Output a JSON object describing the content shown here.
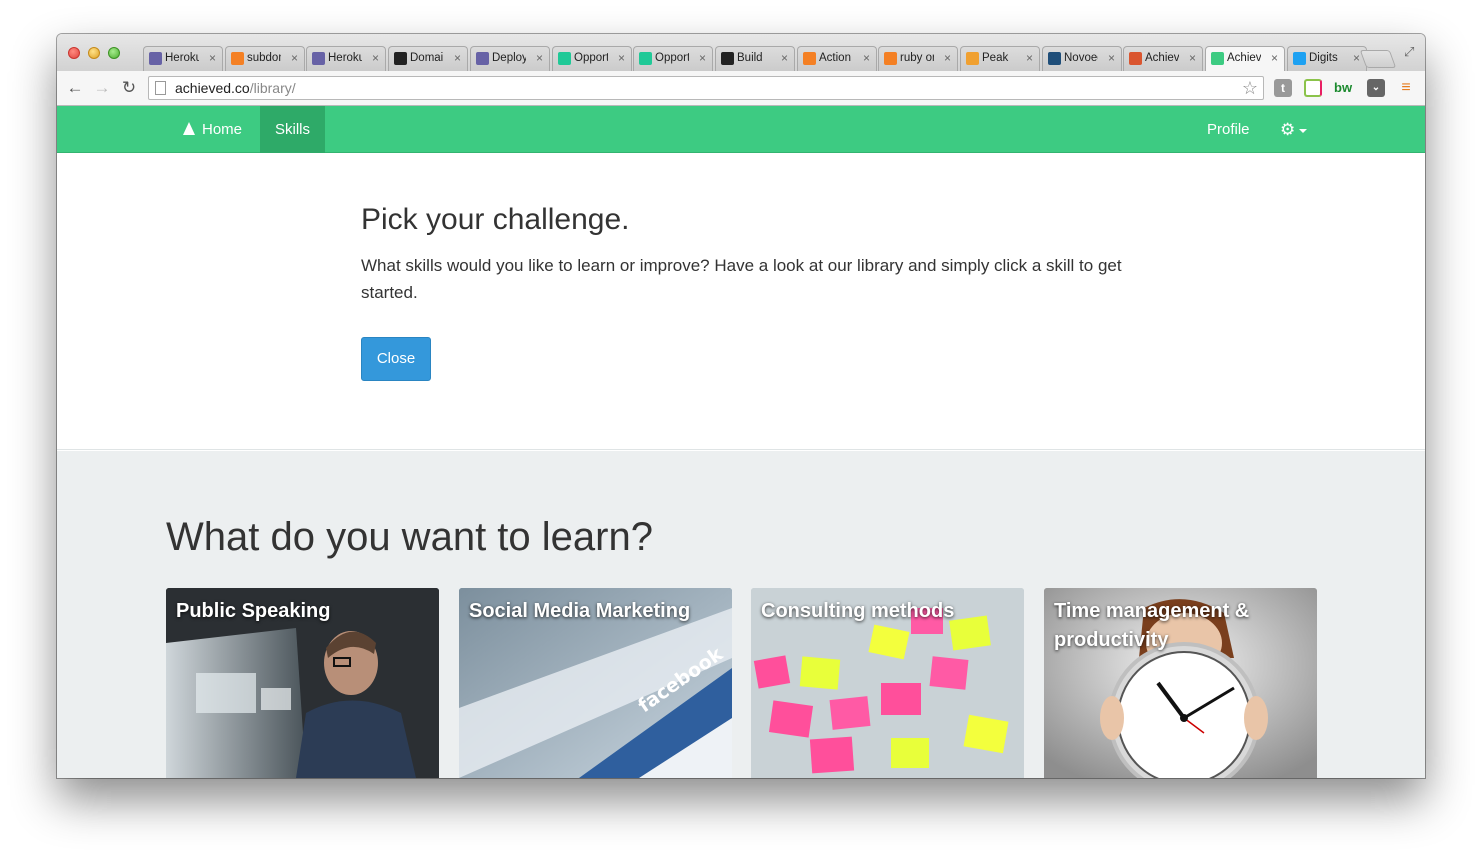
{
  "browser": {
    "tabs": [
      {
        "title": "Heroku",
        "favicon": "heroku-icon",
        "color": "#6762a6"
      },
      {
        "title": "subdomain",
        "favicon": "stackoverflow-icon",
        "color": "#f48024"
      },
      {
        "title": "Heroku",
        "favicon": "heroku-icon",
        "color": "#6762a6"
      },
      {
        "title": "Domains",
        "favicon": "domain-icon",
        "color": "#222222"
      },
      {
        "title": "Deploy",
        "favicon": "heroku-icon",
        "color": "#6762a6"
      },
      {
        "title": "Opportunity",
        "favicon": "circle-icon",
        "color": "#20c997"
      },
      {
        "title": "Opportunity",
        "favicon": "circle-icon",
        "color": "#20c997"
      },
      {
        "title": "Build",
        "favicon": "square-icon",
        "color": "#222222"
      },
      {
        "title": "Action",
        "favicon": "stackoverflow-icon",
        "color": "#f48024"
      },
      {
        "title": "ruby on",
        "favicon": "stackoverflow-icon",
        "color": "#f48024"
      },
      {
        "title": "Peak",
        "favicon": "peak-icon",
        "color": "#f0a030"
      },
      {
        "title": "Novoed",
        "favicon": "novoed-icon",
        "color": "#1f4e79"
      },
      {
        "title": "Achieved",
        "favicon": "producthunt-icon",
        "color": "#da552f"
      },
      {
        "title": "Achieved",
        "favicon": "achieved-icon",
        "color": "#3dcb82"
      },
      {
        "title": "Digits",
        "favicon": "twitter-icon",
        "color": "#1da1f2"
      }
    ],
    "active_tab_index": 13,
    "url_domain": "achieved.co",
    "url_path": "/library/"
  },
  "navbar": {
    "home_label": "Home",
    "skills_label": "Skills",
    "profile_label": "Profile",
    "settings_icon": "gear-icon"
  },
  "hero": {
    "title": "Pick your challenge.",
    "description": "What skills would you like to learn or improve? Have a look at our library and simply click a skill to get started.",
    "close_label": "Close"
  },
  "library": {
    "heading": "What do you want to learn?",
    "skills": [
      {
        "title": "Public Speaking"
      },
      {
        "title": "Social Media Marketing"
      },
      {
        "title": "Consulting methods"
      },
      {
        "title": "Time management & productivity"
      }
    ]
  },
  "colors": {
    "brand_green": "#3dcb82",
    "button_blue": "#3498db",
    "section_gray": "#eceff0"
  }
}
